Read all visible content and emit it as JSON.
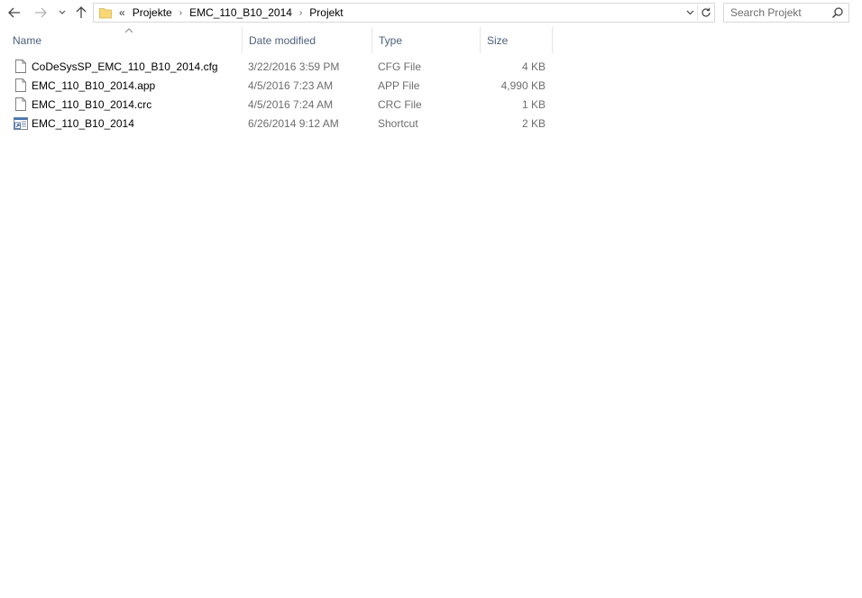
{
  "window": {
    "search_placeholder": "Search Projekt"
  },
  "address": {
    "overflow": "«",
    "crumbs": [
      "Projekte",
      "EMC_110_B10_2014",
      "Projekt"
    ]
  },
  "columns": {
    "name": "Name",
    "date": "Date modified",
    "type": "Type",
    "size": "Size"
  },
  "files": [
    {
      "name": "CoDeSysSP_EMC_110_B10_2014.cfg",
      "date": "3/22/2016 3:59 PM",
      "type": "CFG File",
      "size": "4 KB",
      "icon": "document-icon"
    },
    {
      "name": "EMC_110_B10_2014.app",
      "date": "4/5/2016 7:23 AM",
      "type": "APP File",
      "size": "4,990 KB",
      "icon": "document-icon"
    },
    {
      "name": "EMC_110_B10_2014.crc",
      "date": "4/5/2016 7:24 AM",
      "type": "CRC File",
      "size": "1 KB",
      "icon": "document-icon"
    },
    {
      "name": "EMC_110_B10_2014",
      "date": "6/26/2014 9:12 AM",
      "type": "Shortcut",
      "size": "2 KB",
      "icon": "shortcut-icon"
    }
  ],
  "colors": {
    "header_text": "#4c607a",
    "meta_text": "#6d6d6d",
    "folder_yellow": "#f8d775"
  }
}
